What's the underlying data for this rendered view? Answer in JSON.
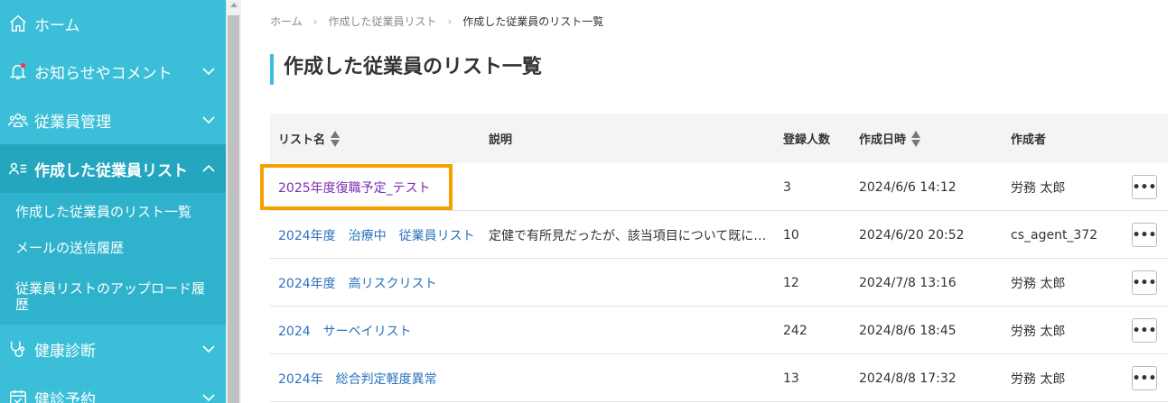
{
  "sidebar": {
    "items": [
      {
        "label": "ホーム"
      },
      {
        "label": "お知らせやコメント"
      },
      {
        "label": "従業員管理"
      },
      {
        "label": "作成した従業員リスト"
      },
      {
        "label": "健康診断"
      },
      {
        "label": "健診予約"
      }
    ],
    "subitems": [
      {
        "label": "作成した従業員のリスト一覧"
      },
      {
        "label": "メールの送信履歴"
      },
      {
        "label": "従業員リストのアップロード履歴"
      }
    ]
  },
  "breadcrumb": {
    "home": "ホーム",
    "sep": "›",
    "parent": "作成した従業員リスト",
    "current": "作成した従業員のリスト一覧"
  },
  "page": {
    "title": "作成した従業員のリスト一覧"
  },
  "table": {
    "headers": {
      "name": "リスト名",
      "description": "説明",
      "count": "登録人数",
      "created_at": "作成日時",
      "creator": "作成者"
    },
    "more_label": "•••",
    "rows": [
      {
        "name": "2025年度復職予定_テスト",
        "description": "",
        "count": "3",
        "created_at": "2024/6/6 14:12",
        "creator": "労務 太郎"
      },
      {
        "name": "2024年度　治療中　従業員リスト",
        "description": "定健で有所見だったが、該当項目について既に…",
        "count": "10",
        "created_at": "2024/6/20 20:52",
        "creator": "cs_agent_372"
      },
      {
        "name": "2024年度　高リスクリスト",
        "description": "",
        "count": "12",
        "created_at": "2024/7/8 13:16",
        "creator": "労務 太郎"
      },
      {
        "name": "2024　サーベイリスト",
        "description": "",
        "count": "242",
        "created_at": "2024/8/6 18:45",
        "creator": "労務 太郎"
      },
      {
        "name": "2024年　総合判定軽度異常",
        "description": "",
        "count": "13",
        "created_at": "2024/8/8 17:32",
        "creator": "労務 太郎"
      }
    ]
  },
  "colors": {
    "sidebar_bg": "#3bbfd8",
    "sidebar_active": "#24a6bf",
    "link": "#2a73c0",
    "visited_link": "#7b2fb0",
    "highlight": "#f5a000"
  }
}
